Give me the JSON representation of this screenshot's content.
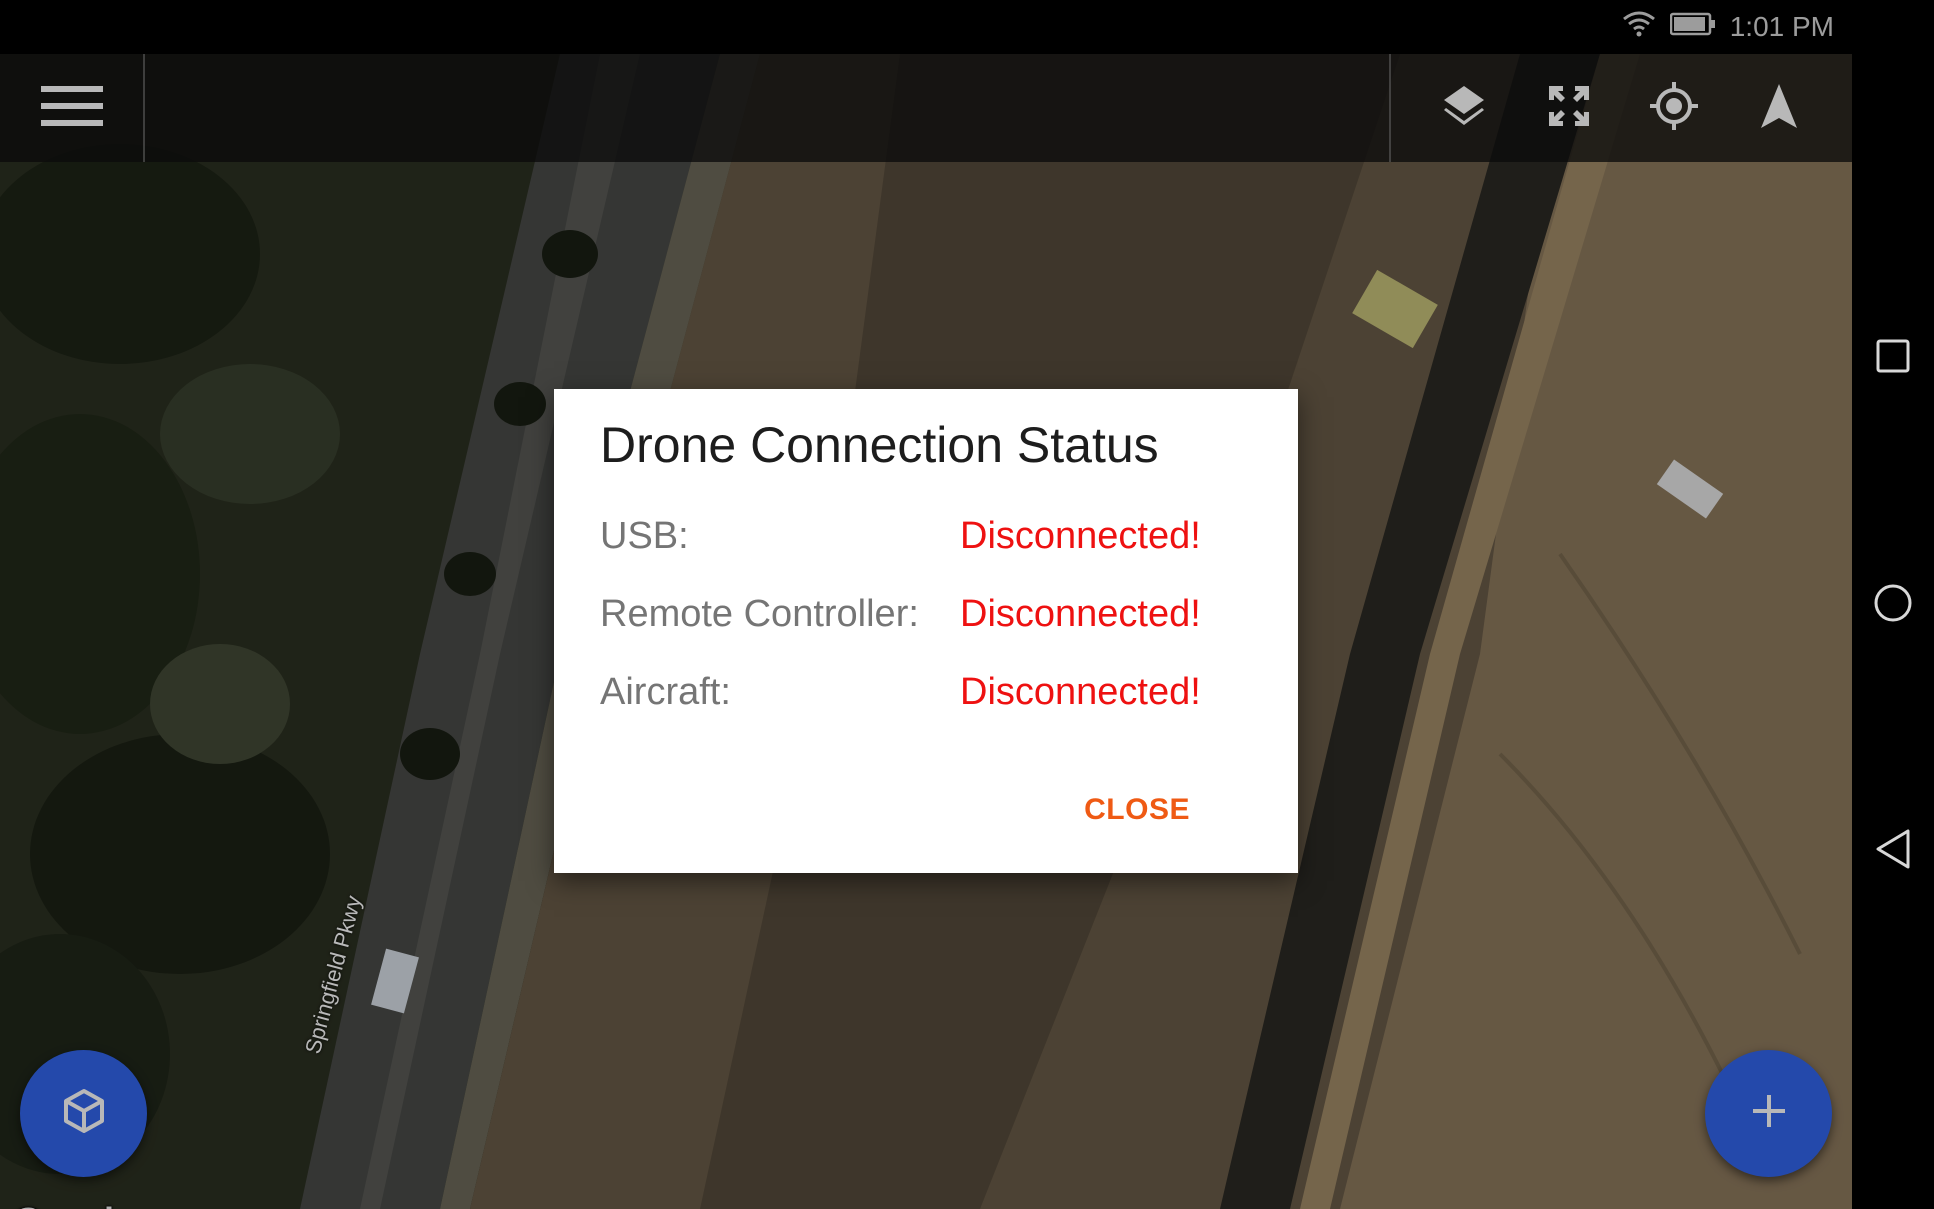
{
  "status_bar": {
    "time": "1:01 PM",
    "icons": [
      "wifi-icon",
      "battery-icon"
    ]
  },
  "toolbar": {
    "left_icon": "hamburger-menu-icon",
    "right_icons": [
      "layers-icon",
      "fullscreen-icon",
      "my-location-icon",
      "navigation-arrow-icon"
    ]
  },
  "map": {
    "road_label": "Springfield Pkwy",
    "provider_logo": "Google"
  },
  "dialog": {
    "title": "Drone Connection Status",
    "rows": [
      {
        "label": "USB:",
        "value": "Disconnected!"
      },
      {
        "label": "Remote Controller:",
        "value": "Disconnected!"
      },
      {
        "label": "Aircraft:",
        "value": "Disconnected!"
      }
    ],
    "close_label": "CLOSE"
  },
  "fabs": {
    "left_icon": "cube-icon",
    "right_icon": "plus-icon"
  },
  "nav_bar": {
    "buttons": [
      "recents-square-icon",
      "home-circle-icon",
      "back-triangle-icon"
    ]
  },
  "colors": {
    "accent_fab": "#3366ee",
    "error_text": "#ee1111",
    "close_button": "#ef5a14",
    "toolbar_bg": "#0f0f0f"
  }
}
